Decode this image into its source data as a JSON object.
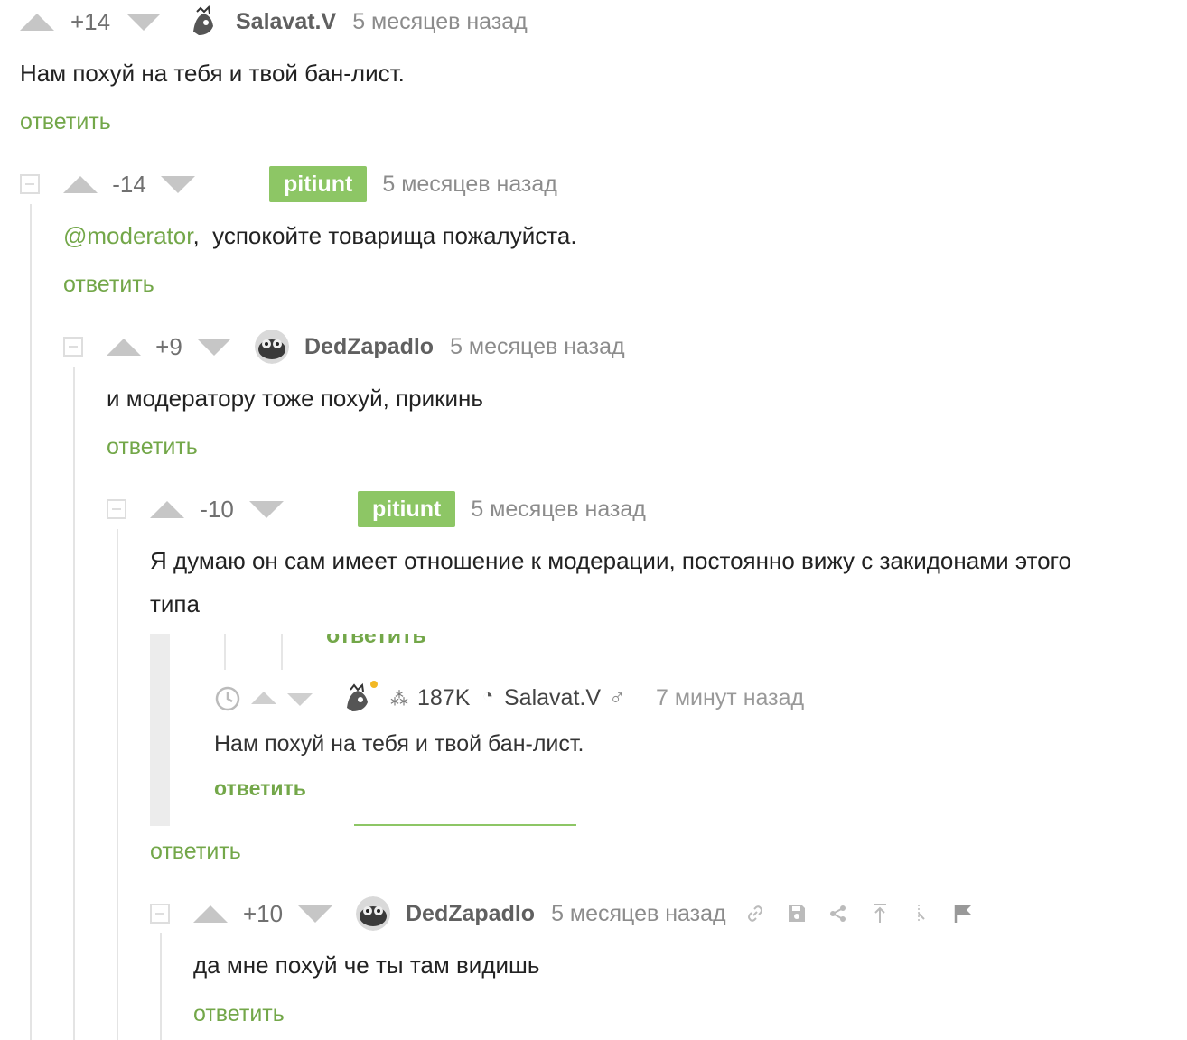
{
  "comments": [
    {
      "rating": "+14",
      "author": "Salavat.V",
      "time": "5 месяцев назад",
      "text": "Нам похуй на тебя и твой бан-лист.",
      "reply_label": "ответить"
    },
    {
      "rating": "-14",
      "author": "pitiunt",
      "time": "5 месяцев назад",
      "mention": "@moderator",
      "text": ",  успокойте товарища пожалуйста.",
      "reply_label": "ответить"
    },
    {
      "rating": "+9",
      "author": "DedZapadlo",
      "time": "5 месяцев назад",
      "text": "и модератору тоже похуй, прикинь",
      "reply_label": "ответить"
    },
    {
      "rating": "-10",
      "author": "pitiunt",
      "time": "5 месяцев назад",
      "text_line1": "Я думаю он сам имеет отношение к модерации, постоянно вижу с закидонами этого",
      "text_line2": "типа",
      "reply_label": "ответить"
    },
    {
      "rating": "+10",
      "author": "DedZapadlo",
      "time": "5 месяцев назад",
      "text": "да мне похуй че ты там видишь",
      "reply_label": "ответить"
    }
  ],
  "embedded_screenshot": {
    "top_reply_label": "ответить",
    "user_rating": "187K",
    "author": "Salavat.V",
    "gender_symbol": "♂",
    "time": "7 минут назад",
    "text": "Нам похуй на тебя и твой бан-лист.",
    "reply_label": "ответить"
  },
  "toolbar_icons": [
    "link-icon",
    "save-icon",
    "share-icon",
    "go-to-top-icon",
    "branch-icon",
    "flag-icon"
  ],
  "colors": {
    "accent_green": "#73a749",
    "badge_green": "#8dc665",
    "vote_arrow": "#c6c6c6",
    "muted_text": "#8c8c8c"
  }
}
